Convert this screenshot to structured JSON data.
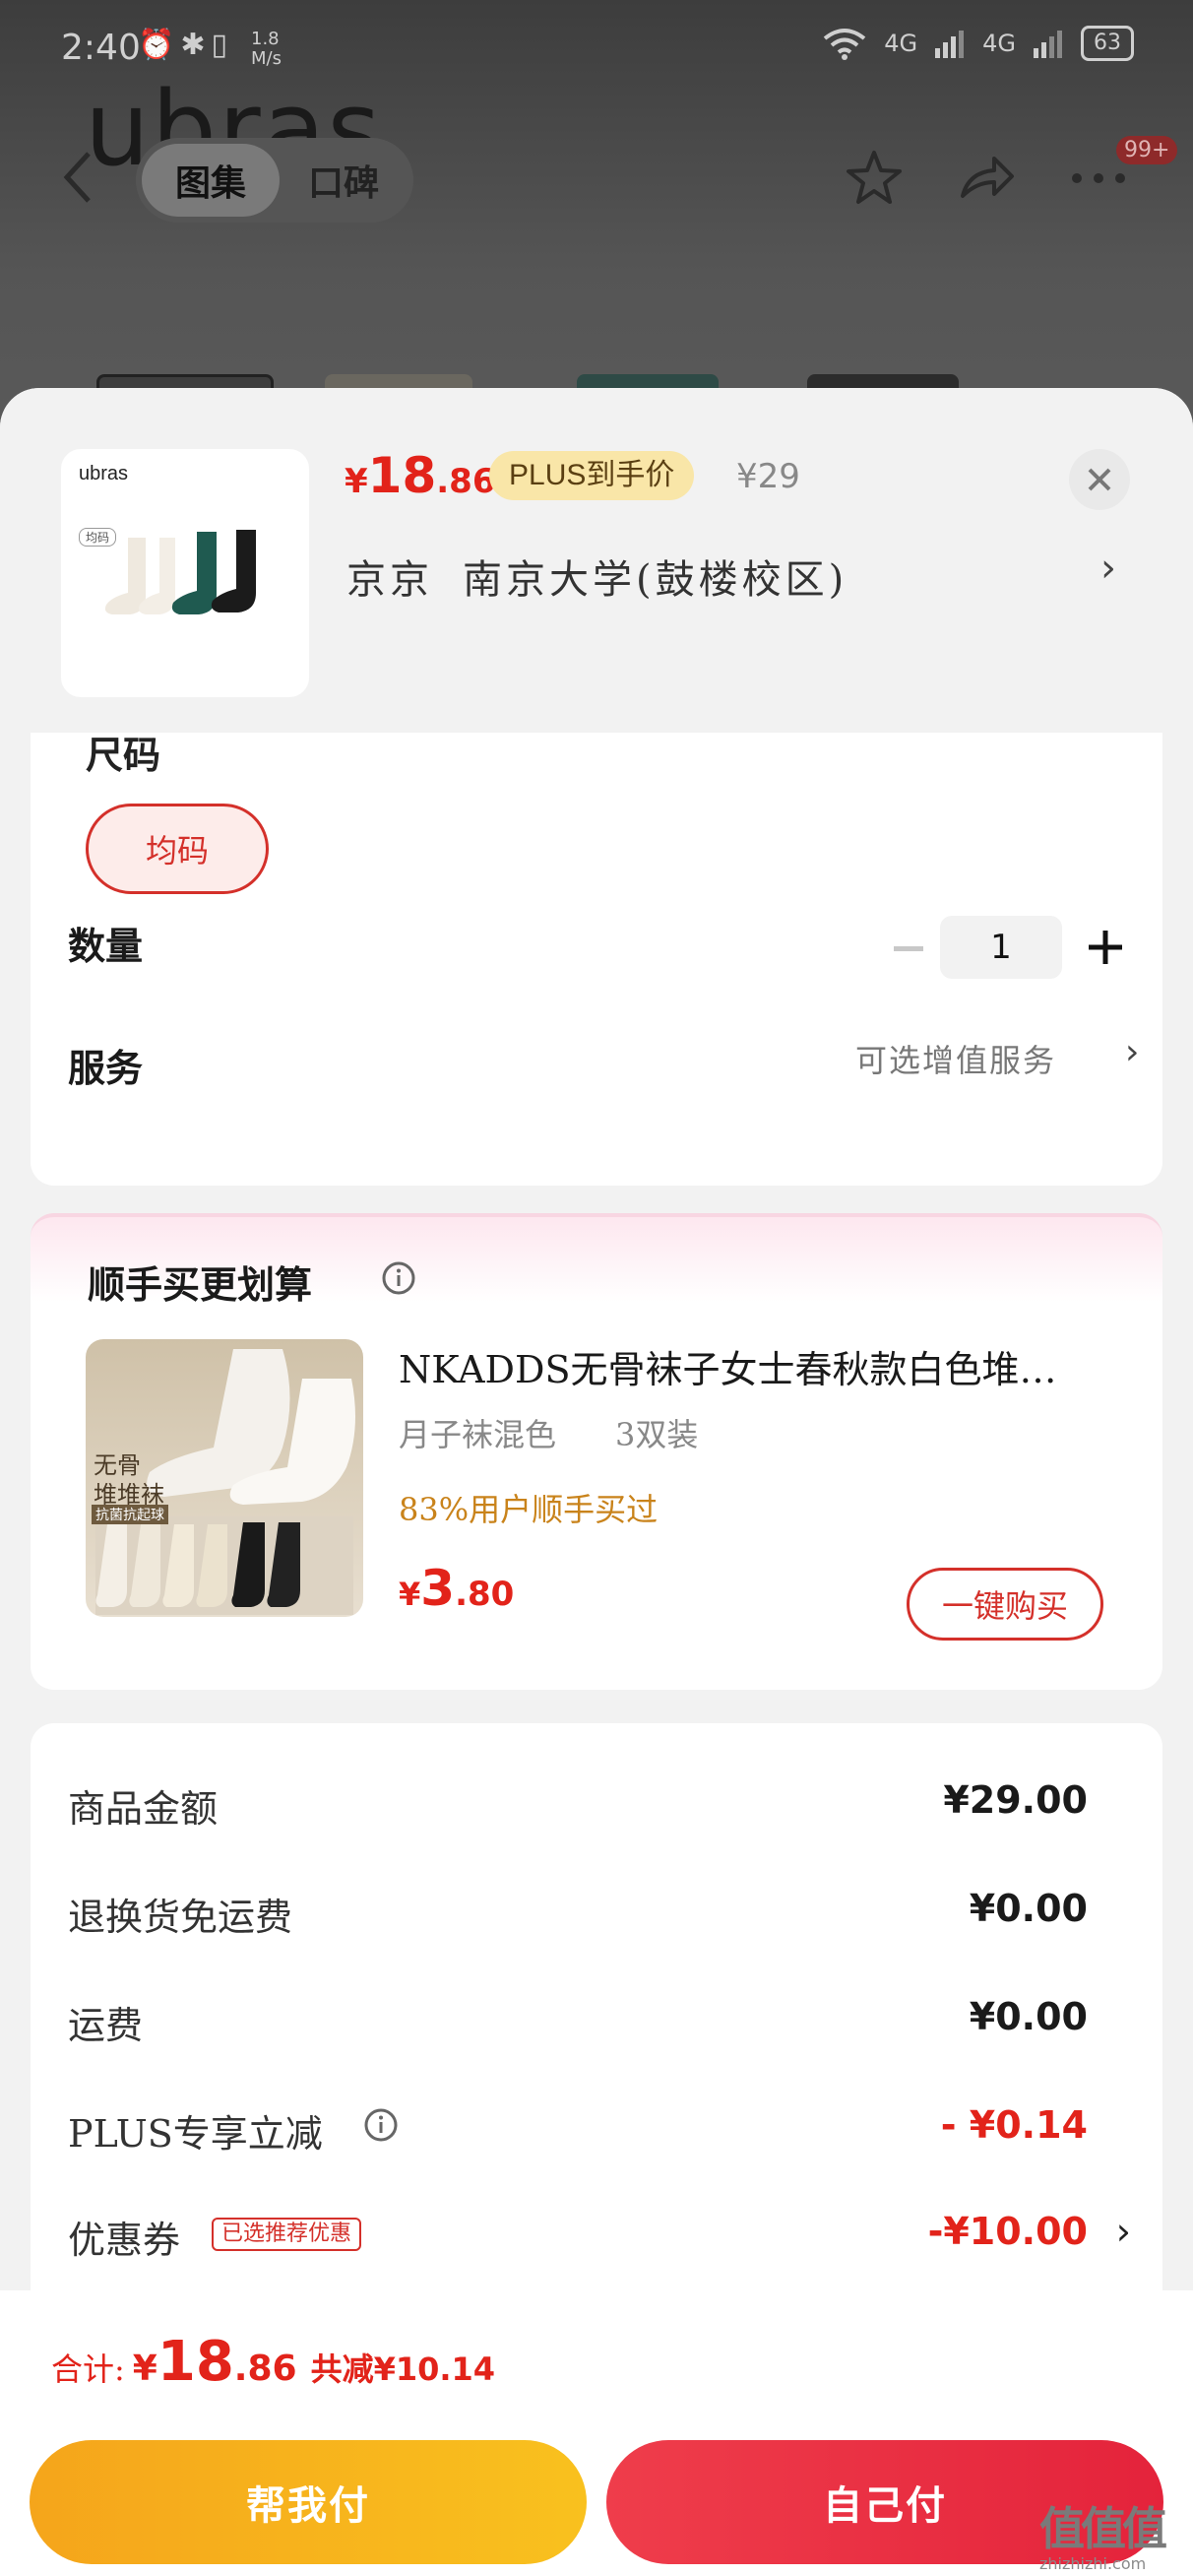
{
  "status_bar": {
    "time": "2:40",
    "speed_value": "1.8",
    "speed_unit": "M/s",
    "network_1": "4G",
    "network_2": "4G",
    "battery": "63"
  },
  "header": {
    "brand_text": "ubras",
    "tabs": [
      {
        "label": "图集",
        "active": true
      },
      {
        "label": "口碑",
        "active": false
      }
    ],
    "badge": "99+",
    "icons": [
      "back-icon",
      "star-icon",
      "share-icon",
      "more-icon"
    ]
  },
  "product": {
    "thumb_brand": "ubras",
    "thumb_tag": "均码",
    "price_yen": "¥",
    "price_int": "18",
    "price_dec": ".86",
    "plus_label": "PLUS到手价",
    "original_price": "¥29",
    "address_city": "京京",
    "address_detail": "南京大学(鼓楼校区)"
  },
  "options": {
    "size_title": "尺码",
    "size_selected": "均码",
    "quantity_label": "数量",
    "quantity_value": "1",
    "service_label": "服务",
    "service_hint": "可选增值服务"
  },
  "bundle": {
    "title": "顺手买更划算",
    "item_name": "NKADDS无骨袜子女士春秋款白色堆…",
    "spec_color": "月子袜混色",
    "spec_pack": "3双装",
    "buyers_text": "83%用户顺手买过",
    "price_yen": "¥",
    "price_int": "3",
    "price_dec": ".80",
    "image_text_1": "无骨",
    "image_text_2": "堆堆袜",
    "image_text_3": "抗菌抗起球",
    "buy_label": "一键购买"
  },
  "totals": {
    "rows": [
      {
        "label": "商品金额",
        "value": "¥29.00"
      },
      {
        "label": "退换货免运费",
        "value": "¥0.00"
      },
      {
        "label": "运费",
        "value": "¥0.00"
      },
      {
        "label": "PLUS专享立减",
        "value": "- ¥0.14"
      },
      {
        "label": "优惠券",
        "value": "-¥10.00",
        "tag": "已选推荐优惠"
      }
    ]
  },
  "footer": {
    "total_label": "合计:",
    "total_yen": "¥",
    "total_int": "18",
    "total_dec": ".86",
    "saved_text": "共减¥10.14",
    "help_pay": "帮我付",
    "self_pay": "自己付"
  },
  "watermark": {
    "logo": "值值值",
    "url": "zhizhizhi.com"
  },
  "colors": {
    "accent_red": "#e2231a",
    "plus_gold": "#f9e6a8",
    "help_pay_yellow": "#f7b21c",
    "self_pay_red": "#e82c41"
  }
}
